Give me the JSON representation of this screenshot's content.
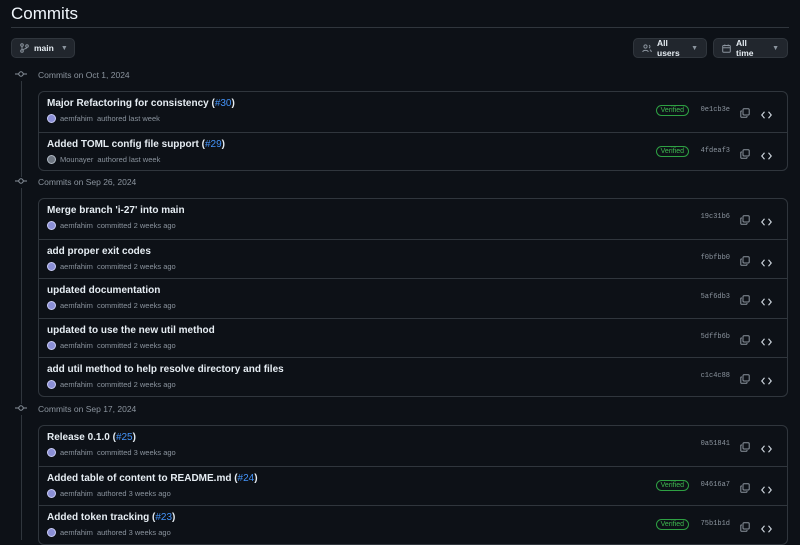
{
  "page": {
    "title": "Commits"
  },
  "toolbar": {
    "branch_label": "main",
    "users_label": "All users",
    "time_label": "All time"
  },
  "groups": [
    {
      "heading": "Commits on Oct 1, 2024",
      "commits": [
        {
          "message": "Major Refactoring for consistency (",
          "pr": "#30",
          "close": ")",
          "author": "aemfahim",
          "action": "authored last week",
          "verified": "Verified",
          "sha": "0e1cb3e"
        },
        {
          "message": "Added TOML config file support (",
          "pr": "#29",
          "close": ")",
          "author": "Mounayer",
          "action": "authored last week",
          "verified": "Verified",
          "sha": "4fdeaf3"
        }
      ]
    },
    {
      "heading": "Commits on Sep 26, 2024",
      "commits": [
        {
          "message": "Merge branch 'i-27' into main",
          "pr": "",
          "close": "",
          "author": "aemfahim",
          "action": "committed 2 weeks ago",
          "verified": "",
          "sha": "19c31b6"
        },
        {
          "message": "add proper exit codes",
          "pr": "",
          "close": "",
          "author": "aemfahim",
          "action": "committed 2 weeks ago",
          "verified": "",
          "sha": "f0bfbb0"
        },
        {
          "message": "updated documentation",
          "pr": "",
          "close": "",
          "author": "aemfahim",
          "action": "committed 2 weeks ago",
          "verified": "",
          "sha": "5af6db3"
        },
        {
          "message": "updated to use the new util method",
          "pr": "",
          "close": "",
          "author": "aemfahim",
          "action": "committed 2 weeks ago",
          "verified": "",
          "sha": "5dffb6b"
        },
        {
          "message": "add util method to help resolve directory and files",
          "pr": "",
          "close": "",
          "author": "aemfahim",
          "action": "committed 2 weeks ago",
          "verified": "",
          "sha": "c1c4c88"
        }
      ]
    },
    {
      "heading": "Commits on Sep 17, 2024",
      "commits": [
        {
          "message": "Release 0.1.0 (",
          "pr": "#25",
          "close": ")",
          "author": "aemfahim",
          "action": "committed 3 weeks ago",
          "verified": "",
          "sha": "0a51841"
        },
        {
          "message": "Added table of content to README.md (",
          "pr": "#24",
          "close": ")",
          "author": "aemfahim",
          "action": "authored 3 weeks ago",
          "verified": "Verified",
          "sha": "04616a7"
        },
        {
          "message": "Added token tracking (",
          "pr": "#23",
          "close": ")",
          "author": "aemfahim",
          "action": "authored 3 weeks ago",
          "verified": "Verified",
          "sha": "75b1b1d"
        }
      ]
    }
  ]
}
